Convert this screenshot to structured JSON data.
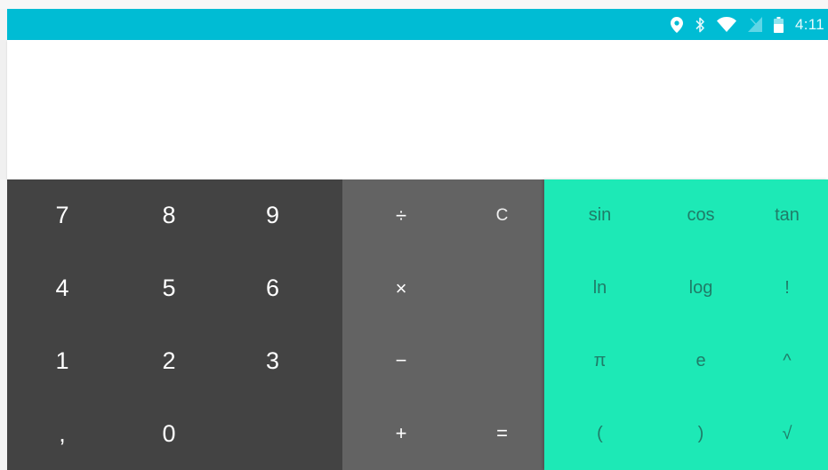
{
  "status_bar": {
    "time": "4:11",
    "icons": [
      "location-icon",
      "bluetooth-icon",
      "wifi-icon",
      "no-sim-icon",
      "battery-icon"
    ],
    "background": "#00bcd4"
  },
  "display": {
    "formula": "",
    "result": ""
  },
  "numeric_pad": {
    "background": "#434343",
    "keys": {
      "seven": "7",
      "eight": "8",
      "nine": "9",
      "four": "4",
      "five": "5",
      "six": "6",
      "one": "1",
      "two": "2",
      "three": "3",
      "decimal": ",",
      "zero": "0"
    }
  },
  "operator_pad": {
    "background": "#636363",
    "keys": {
      "divide": "÷",
      "clear": "C",
      "multiply": "×",
      "minus": "−",
      "plus": "+",
      "equals": "="
    }
  },
  "advanced_pad": {
    "background": "#1de9b6",
    "keys": {
      "sin": "sin",
      "cos": "cos",
      "tan": "tan",
      "ln": "ln",
      "log": "log",
      "factorial": "!",
      "pi": "π",
      "e": "e",
      "power": "^",
      "left_paren": "(",
      "right_paren": ")",
      "sqrt": "√"
    }
  }
}
